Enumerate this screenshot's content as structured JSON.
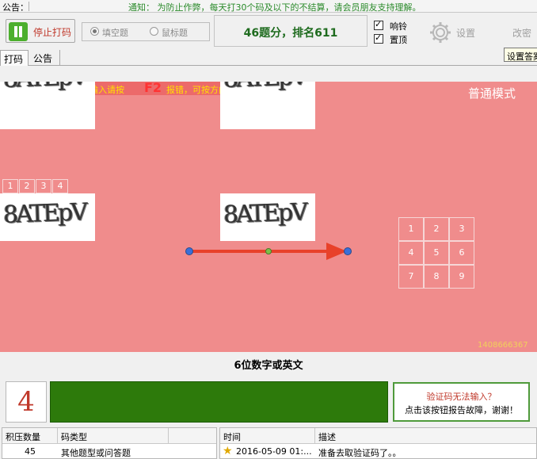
{
  "notice": {
    "label": "公告：",
    "text": "通知： 为防止作弊，每天打30个码及以下的不结算，请会员朋友支持理解。"
  },
  "controls": {
    "stop_button": "停止打码",
    "radio_fill": "填空题",
    "radio_mouse": "鼠标题",
    "score": "46题分，排名611",
    "chk_sound": "响铃",
    "chk_top": "置顶",
    "settings": "设置",
    "modify": "改密",
    "tooltip": "设置答案"
  },
  "tabs": {
    "active": "打码",
    "inactive": "公告"
  },
  "captcha": {
    "hint": "遇到无效图片或者不能输入请按",
    "hint_key": "F2",
    "hint_after": "报错，可按方向键选",
    "mode": "普通模式",
    "image_text": "8ATEpV",
    "number_strip": [
      "1",
      "2",
      "3",
      "4"
    ],
    "grid": [
      "1",
      "2",
      "3",
      "4",
      "5",
      "6",
      "7",
      "8",
      "9"
    ],
    "id": "1408666367"
  },
  "question_type": "6位数字或英文",
  "counter": "4",
  "report": {
    "line1": "验证码无法输入？",
    "line2": "点击该按钮报告故障，谢谢！"
  },
  "queue_table": {
    "headers": [
      "积压数量",
      "码类型"
    ],
    "row": [
      "45",
      "其他题型或问答题"
    ]
  },
  "log_table": {
    "headers": [
      "时间",
      "描述"
    ],
    "row": [
      "2016-05-09 01:...",
      "准备去取验证码了。。"
    ]
  },
  "colors": {
    "captcha_bg": "#f08c8c",
    "input_bg": "#2d7a0b",
    "accent_red": "#c0392b"
  }
}
